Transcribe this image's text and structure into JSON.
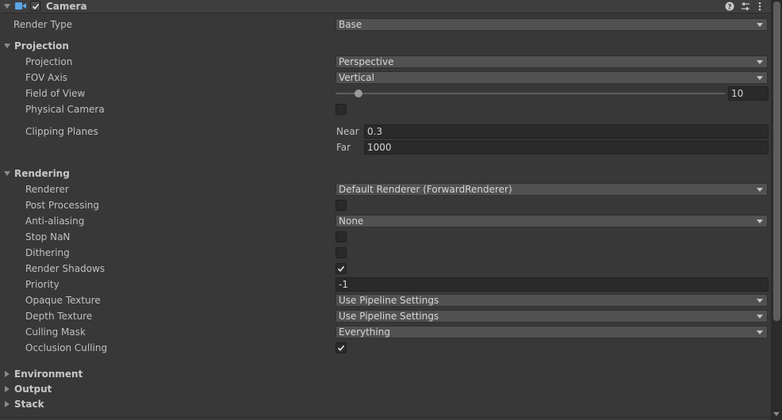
{
  "component": {
    "title": "Camera",
    "enabled": true,
    "icons": [
      "help-icon",
      "presets-icon",
      "more-icon"
    ]
  },
  "render_type": {
    "label": "Render Type",
    "value": "Base"
  },
  "projection_section": {
    "title": "Projection",
    "projection": {
      "label": "Projection",
      "value": "Perspective"
    },
    "fov_axis": {
      "label": "FOV Axis",
      "value": "Vertical"
    },
    "field_of_view": {
      "label": "Field of View",
      "value": "10",
      "slider_fraction": 0.06
    },
    "physical_camera": {
      "label": "Physical Camera",
      "checked": false
    },
    "clipping_planes": {
      "label": "Clipping Planes",
      "near_label": "Near",
      "near_value": "0.3",
      "far_label": "Far",
      "far_value": "1000"
    }
  },
  "rendering_section": {
    "title": "Rendering",
    "renderer": {
      "label": "Renderer",
      "value": "Default Renderer (ForwardRenderer)"
    },
    "post_processing": {
      "label": "Post Processing",
      "checked": false
    },
    "anti_aliasing": {
      "label": "Anti-aliasing",
      "value": "None"
    },
    "stop_nan": {
      "label": "Stop NaN",
      "checked": false
    },
    "dithering": {
      "label": "Dithering",
      "checked": false
    },
    "render_shadows": {
      "label": "Render Shadows",
      "checked": true
    },
    "priority": {
      "label": "Priority",
      "value": "-1"
    },
    "opaque_texture": {
      "label": "Opaque Texture",
      "value": "Use Pipeline Settings"
    },
    "depth_texture": {
      "label": "Depth Texture",
      "value": "Use Pipeline Settings"
    },
    "culling_mask": {
      "label": "Culling Mask",
      "value": "Everything"
    },
    "occlusion_culling": {
      "label": "Occlusion Culling",
      "checked": true
    }
  },
  "collapsed_sections": {
    "environment": "Environment",
    "output": "Output",
    "stack": "Stack"
  },
  "colors": {
    "background": "#383838",
    "header": "#3e3e3e",
    "dropdown": "#515151",
    "field": "#2a2a2a",
    "camera_icon": "#5aa7e6"
  }
}
